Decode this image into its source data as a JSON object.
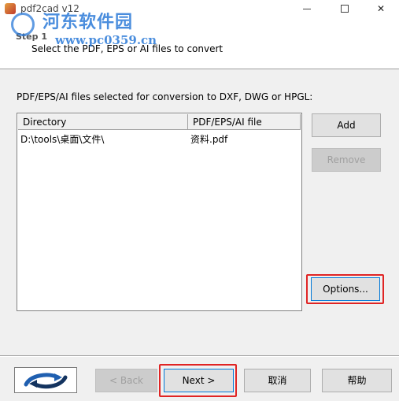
{
  "window": {
    "title": "pdf2cad v12",
    "minimize_glyph": "—",
    "maximize_glyph": "☐",
    "close_glyph": "✕"
  },
  "watermark": {
    "title": "河东软件园",
    "url": "www.pc0359.cn"
  },
  "header": {
    "step_label": "Step 1",
    "step_description": "Select the PDF, EPS or AI files to convert"
  },
  "main": {
    "section_label": "PDF/EPS/AI files selected for conversion to DXF, DWG or HPGL:",
    "list": {
      "columns": [
        "Directory",
        "PDF/EPS/AI file"
      ],
      "rows": [
        {
          "directory": "D:\\tools\\桌面\\文件\\",
          "file": "资料.pdf"
        }
      ]
    },
    "buttons": {
      "add": "Add",
      "remove": "Remove",
      "options": "Options..."
    }
  },
  "footer": {
    "logo_icon": "curved-arrows-logo-icon",
    "back": "< Back",
    "next": "Next >",
    "cancel": "取消",
    "help": "帮助"
  },
  "colors": {
    "highlight": "#e02424",
    "accent": "#0078d7",
    "watermark": "#2b7ad8"
  }
}
